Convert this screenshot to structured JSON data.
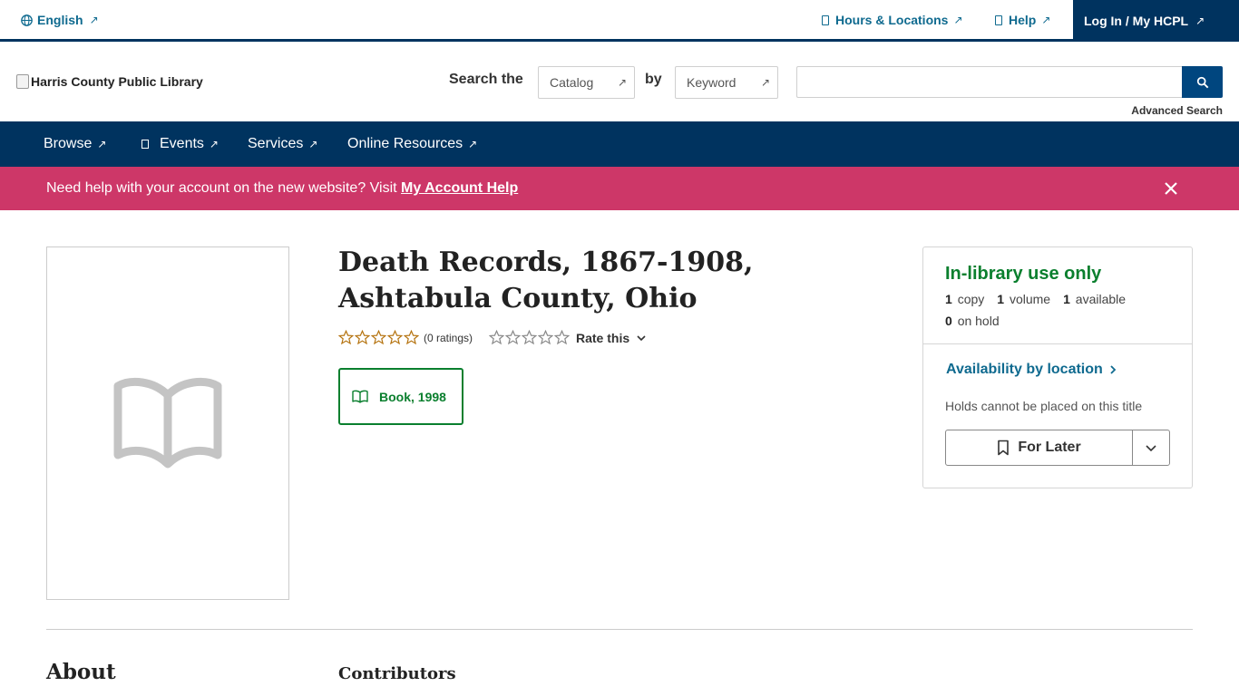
{
  "utility": {
    "language": "English",
    "hours": "Hours & Locations",
    "help": "Help",
    "login": "Log In / My HCPL",
    "external_glyph": "↗"
  },
  "header": {
    "logo_alt": "Harris County Public Library",
    "search_the": "Search the",
    "catalog": "Catalog",
    "by": "by",
    "keyword": "Keyword",
    "search_placeholder": "",
    "advanced": "Advanced Search"
  },
  "nav": {
    "browse": "Browse",
    "events": "Events",
    "services": "Services",
    "online": "Online Resources"
  },
  "alert": {
    "text": "Need help with your account on the new website? Visit ",
    "link": "My Account Help"
  },
  "item": {
    "title": "Death Records, 1867-1908, Ashtabula County, Ohio",
    "rating_count": "(0 ratings)",
    "rate_this": "Rate this",
    "format": "Book, 1998",
    "rating_value": 0,
    "rating_max": 5
  },
  "availability": {
    "status": "In-library use only",
    "copies_num": "1",
    "copies_label": "copy",
    "volumes_num": "1",
    "volumes_label": "volume",
    "available_num": "1",
    "available_label": "available",
    "hold_num": "0",
    "hold_label": "on hold",
    "by_location": "Availability by location",
    "holds_note": "Holds cannot be placed on this title",
    "for_later": "For Later"
  },
  "sections": {
    "about": "About",
    "contributors": "Contributors"
  },
  "colors": {
    "navy": "#00335f",
    "link": "#0f6a8f",
    "alert": "#cd3768",
    "green": "#0a7f2e",
    "star": "#b5730f"
  }
}
